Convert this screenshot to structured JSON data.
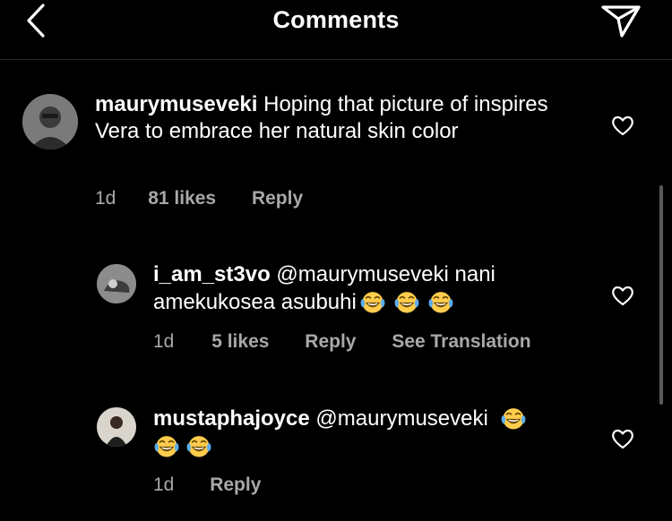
{
  "header": {
    "title": "Comments",
    "back_icon": "chevron-left-icon",
    "send_icon": "paper-plane-icon"
  },
  "comments": [
    {
      "username": "maurymuseveki",
      "text": "Hoping that picture of inspires Vera to embrace her natural skin color",
      "time": "1d",
      "likes": "81 likes",
      "reply": "Reply"
    },
    {
      "username": "i_am_st3vo",
      "text": "@maurymuseveki nani amekukosea asubuhi",
      "emoji_count": 3,
      "time": "1d",
      "likes": "5 likes",
      "reply": "Reply",
      "translate": "See Translation"
    },
    {
      "username": "mustaphajoyce",
      "text": "@maurymuseveki",
      "emoji_count": 3,
      "time": "1d",
      "reply": "Reply"
    }
  ],
  "colors": {
    "background": "#000000",
    "text": "#ffffff",
    "meta": "#a8a8a8",
    "emoji_face": "#ffcc4d"
  }
}
